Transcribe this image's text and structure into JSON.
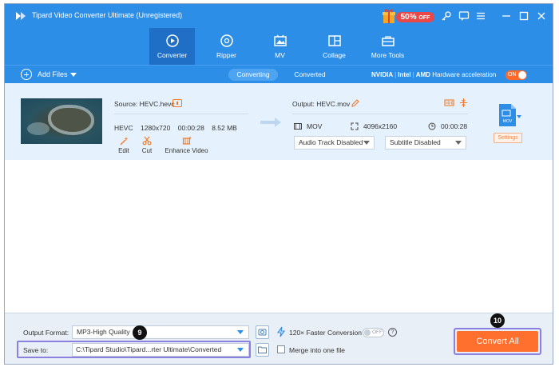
{
  "app": {
    "title": "Tipard Video Converter Ultimate (Unregistered)",
    "promo": "50%",
    "promo_suffix": "OFF"
  },
  "tabs": [
    {
      "label": "Converter",
      "icon": "converter-icon",
      "active": true
    },
    {
      "label": "Ripper",
      "icon": "disc-icon",
      "active": false
    },
    {
      "label": "MV",
      "icon": "mv-icon",
      "active": false
    },
    {
      "label": "Collage",
      "icon": "collage-icon",
      "active": false
    },
    {
      "label": "More Tools",
      "icon": "toolbox-icon",
      "active": false
    }
  ],
  "subbar": {
    "add_files": "Add Files",
    "converting": "Converting",
    "converted": "Converted",
    "hw_nvidia": "NVIDIA",
    "hw_intel": "Intel",
    "hw_amd": "AMD",
    "hw_label": "Hardware acceleration",
    "hw_toggle": "ON"
  },
  "file": {
    "source": "Source: HEVC.hevc",
    "codec": "HEVC",
    "resolution": "1280x720",
    "duration": "00:00:28",
    "size": "8.52 MB",
    "actions": [
      "Edit",
      "Cut",
      "Enhance Video"
    ],
    "output": "Output: HEVC.mov",
    "out_format": "MOV",
    "out_resolution": "4096x2160",
    "out_duration": "00:00:28",
    "audio_track": "Audio Track Disabled",
    "subtitle": "Subtitle Disabled",
    "format_badge": "MOV",
    "settings": "Settings"
  },
  "bottom": {
    "output_format_label": "Output Format:",
    "output_format_value": "MP3-High Quality",
    "save_to_label": "Save to:",
    "save_to_value": "C:\\Tipard Studio\\Tipard...rter Ultimate\\Converted",
    "speed_label": "120× Faster Conversion",
    "speed_toggle": "OFF",
    "merge_label": "Merge into one file",
    "convert_all": "Convert All",
    "step_badge_9": "9",
    "step_badge_10": "10"
  },
  "colors": {
    "brand_blue": "#2d8ee8",
    "accent_orange": "#ff6f2e",
    "highlight_purple": "#8b7fe0"
  }
}
